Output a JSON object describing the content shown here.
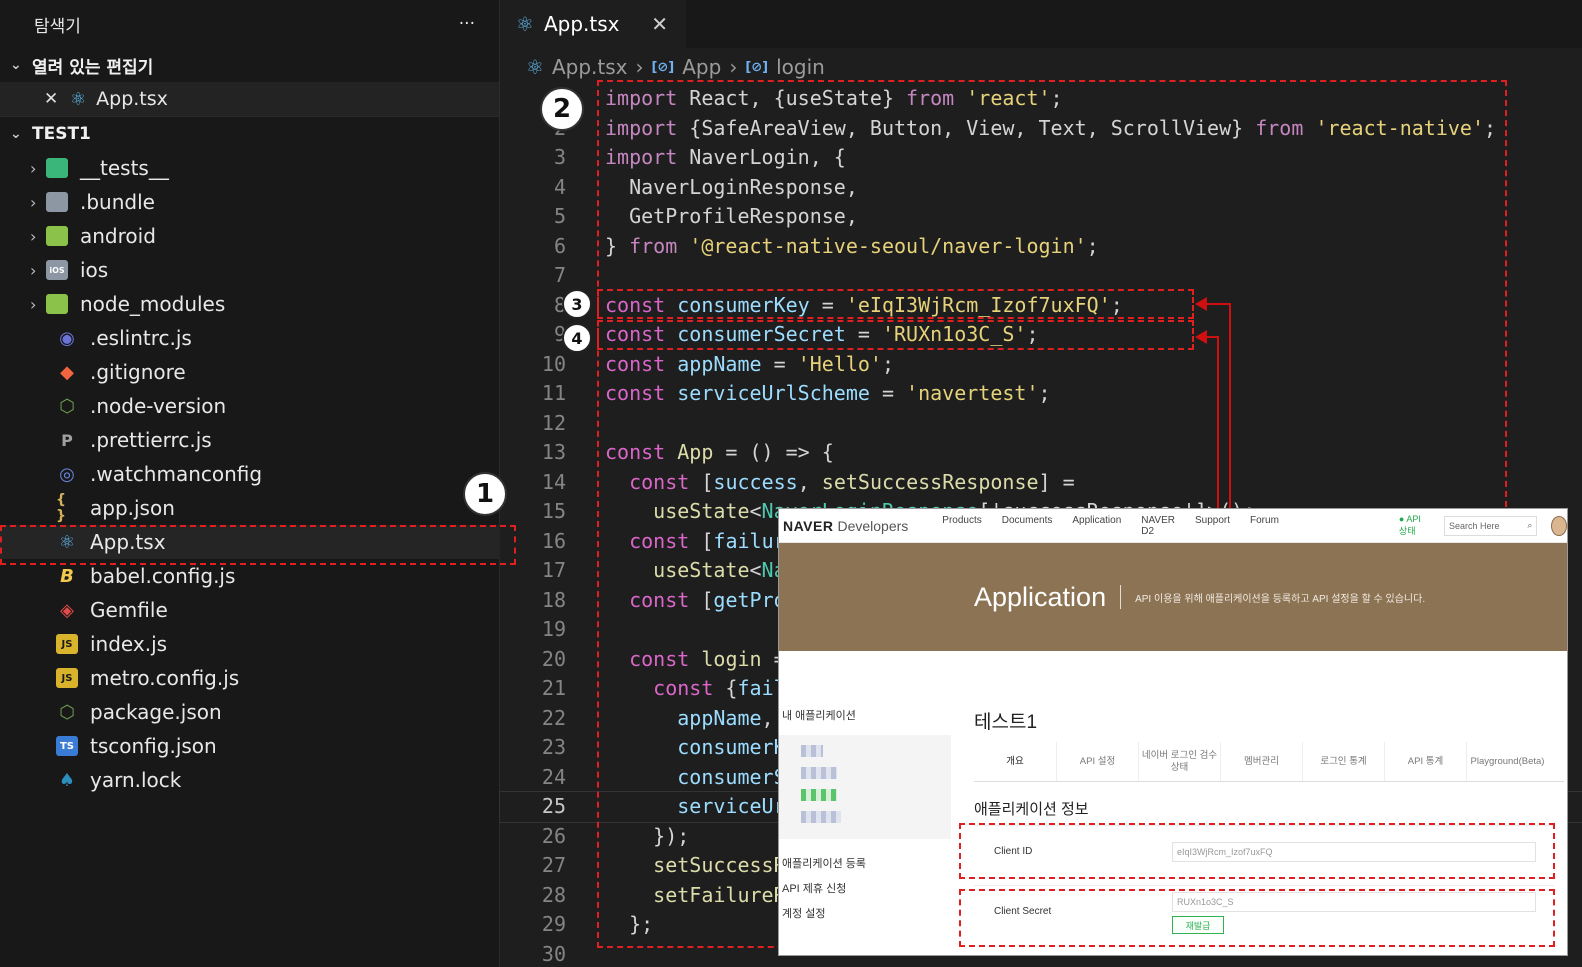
{
  "sidebar": {
    "title": "탐색기",
    "more": "···",
    "open_editors": {
      "label": "열려 있는 편집기",
      "item": "App.tsx"
    },
    "project": "TEST1",
    "tree": [
      {
        "label": "__tests__",
        "type": "folder",
        "icon": "folder-test-icon"
      },
      {
        "label": ".bundle",
        "type": "folder",
        "icon": "folder-icon"
      },
      {
        "label": "android",
        "type": "folder",
        "icon": "folder-android-icon"
      },
      {
        "label": "ios",
        "type": "folder",
        "icon": "folder-ios-icon"
      },
      {
        "label": "node_modules",
        "type": "folder",
        "icon": "folder-node-icon"
      },
      {
        "label": ".eslintrc.js",
        "type": "file",
        "icon": "eslint-icon"
      },
      {
        "label": ".gitignore",
        "type": "file",
        "icon": "git-icon"
      },
      {
        "label": ".node-version",
        "type": "file",
        "icon": "nodejs-icon"
      },
      {
        "label": ".prettierrc.js",
        "type": "file",
        "icon": "prettier-icon"
      },
      {
        "label": ".watchmanconfig",
        "type": "file",
        "icon": "watchman-icon"
      },
      {
        "label": "app.json",
        "type": "file",
        "icon": "json-icon"
      },
      {
        "label": "App.tsx",
        "type": "file",
        "icon": "react-icon"
      },
      {
        "label": "babel.config.js",
        "type": "file",
        "icon": "babel-icon"
      },
      {
        "label": "Gemfile",
        "type": "file",
        "icon": "gem-icon"
      },
      {
        "label": "index.js",
        "type": "file",
        "icon": "js-icon"
      },
      {
        "label": "metro.config.js",
        "type": "file",
        "icon": "js-icon"
      },
      {
        "label": "package.json",
        "type": "file",
        "icon": "nodejs-icon"
      },
      {
        "label": "tsconfig.json",
        "type": "file",
        "icon": "tsconfig-icon"
      },
      {
        "label": "yarn.lock",
        "type": "file",
        "icon": "yarn-icon"
      }
    ]
  },
  "editor": {
    "tab": "App.tsx",
    "breadcrumb": [
      "App.tsx",
      "App",
      "login"
    ],
    "current_line": 25
  },
  "annotations": {
    "badge1": "1",
    "badge2": "2",
    "badge3": "3",
    "badge4": "4",
    "color": "#e02020"
  },
  "naver": {
    "logo": "NAVER",
    "logo_suffix": "Developers",
    "nav": [
      "Products",
      "Documents",
      "Application",
      "NAVER D2",
      "Support",
      "Forum"
    ],
    "status": "API 상태",
    "search_placeholder": "Search Here",
    "banner_title": "Application",
    "banner_desc": "API 이용을 위해 애플리케이션을 등록하고 API 설정을 할 수 있습니다.",
    "side_head": "내 애플리케이션",
    "side_links": [
      "애플리케이션 등록",
      "API 제휴 신청",
      "계정 설정"
    ],
    "app_title": "테스트1",
    "tabs": [
      "개요",
      "API 설정",
      "네이버 로그인 검수상태",
      "멤버관리",
      "로그인 통계",
      "API 통계",
      "Playground(Beta)"
    ],
    "section": "애플리케이션 정보",
    "client_id_label": "Client ID",
    "client_id_value": "eIqI3WjRcm_Izof7uxFQ",
    "client_secret_label": "Client Secret",
    "client_secret_value": "RUXn1o3C_S",
    "regen_button": "재발급",
    "accent": "#31b254",
    "banner_color": "#8c7353"
  }
}
